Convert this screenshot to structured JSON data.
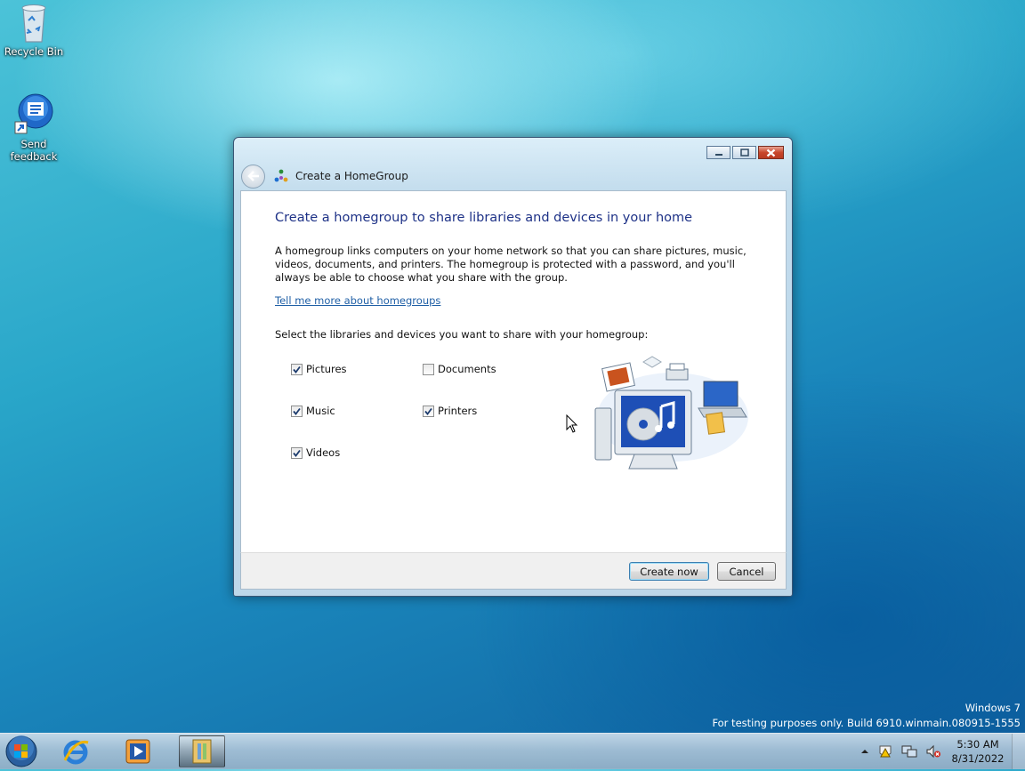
{
  "desktop": {
    "icons": [
      {
        "label": "Recycle Bin",
        "icon": "recycle-bin-icon"
      },
      {
        "label_line1": "Send",
        "label_line2": "feedback",
        "icon": "send-feedback-icon"
      }
    ]
  },
  "window": {
    "title": "Create a HomeGroup",
    "heading": "Create a homegroup to share libraries and devices in your home",
    "description": "A homegroup links computers on your home network so that you can share pictures, music, videos, documents, and printers. The homegroup is protected with a password, and you'll always be able to choose what you share with the group.",
    "link": "Tell me more about homegroups",
    "select_label": "Select the libraries and devices you want to share with your homegroup:",
    "checkboxes": [
      {
        "label": "Pictures",
        "checked": true
      },
      {
        "label": "Documents",
        "checked": false
      },
      {
        "label": "Music",
        "checked": true
      },
      {
        "label": "Printers",
        "checked": true
      },
      {
        "label": "Videos",
        "checked": true
      }
    ],
    "buttons": {
      "create": "Create now",
      "cancel": "Cancel"
    }
  },
  "watermark": {
    "line1": "Windows  7",
    "line2": "For testing purposes only. Build 6910.winmain.080915-1555"
  },
  "taskbar": {
    "pinned": [
      "start-orb",
      "internet-explorer-icon",
      "media-player-icon",
      "homegroup-window-icon"
    ],
    "clock": {
      "time": "5:30 AM",
      "date": "8/31/2022"
    }
  },
  "colors": {
    "heading": "#1e3287",
    "link": "#1f5fa6",
    "close_button": "#c8462b"
  }
}
